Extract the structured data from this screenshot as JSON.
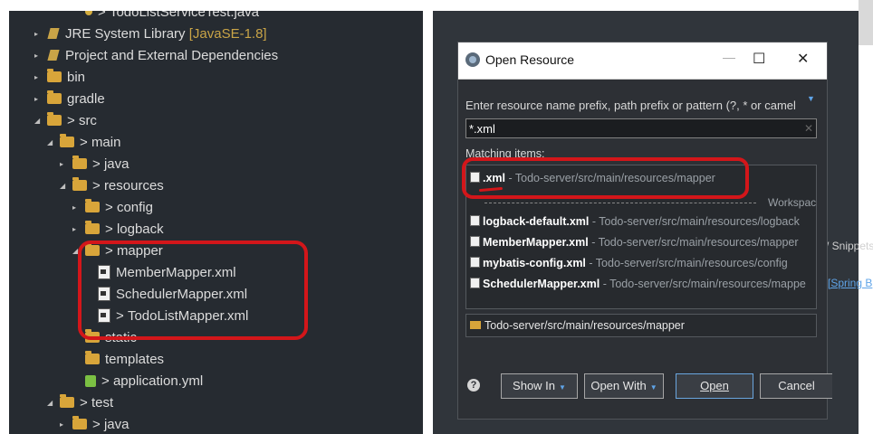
{
  "project_explorer": {
    "rows": [
      {
        "label": "TodoListServiceTest.java",
        "prefix": "> ",
        "indent": 4,
        "icon": "java-file-icon",
        "expand": ""
      },
      {
        "label": "JRE System Library",
        "suffix": " [JavaSE-1.8]",
        "prefix": "",
        "indent": 1,
        "icon": "library-icon",
        "expand": "▸"
      },
      {
        "label": "Project and External Dependencies",
        "prefix": "",
        "indent": 1,
        "icon": "library-icon",
        "expand": "▸"
      },
      {
        "label": "bin",
        "prefix": "",
        "indent": 1,
        "icon": "folder-icon",
        "expand": "▸"
      },
      {
        "label": "gradle",
        "prefix": "",
        "indent": 1,
        "icon": "folder-icon",
        "expand": "▸"
      },
      {
        "label": "src",
        "prefix": "> ",
        "indent": 1,
        "icon": "folder-icon",
        "expand": "◢"
      },
      {
        "label": "main",
        "prefix": "> ",
        "indent": 2,
        "icon": "folder-icon",
        "expand": "◢"
      },
      {
        "label": "java",
        "prefix": "> ",
        "indent": 3,
        "icon": "folder-icon",
        "expand": "▸"
      },
      {
        "label": "resources",
        "prefix": "> ",
        "indent": 3,
        "icon": "folder-icon",
        "expand": "◢"
      },
      {
        "label": "config",
        "prefix": "> ",
        "indent": 4,
        "icon": "folder-icon",
        "expand": "▸"
      },
      {
        "label": "logback",
        "prefix": "> ",
        "indent": 4,
        "icon": "folder-icon",
        "expand": "▸"
      },
      {
        "label": "mapper",
        "prefix": "> ",
        "indent": 4,
        "icon": "folder-icon",
        "expand": "◢"
      },
      {
        "label": "MemberMapper.xml",
        "prefix": "",
        "indent": 5,
        "icon": "xml-file-icon",
        "expand": ""
      },
      {
        "label": "SchedulerMapper.xml",
        "prefix": "",
        "indent": 5,
        "icon": "xml-file-icon",
        "expand": ""
      },
      {
        "label": "TodoListMapper.xml",
        "prefix": "> ",
        "indent": 5,
        "icon": "xml-file-icon",
        "expand": ""
      },
      {
        "label": "static",
        "prefix": "",
        "indent": 4,
        "icon": "folder-icon",
        "expand": ""
      },
      {
        "label": "templates",
        "prefix": "",
        "indent": 4,
        "icon": "folder-icon",
        "expand": ""
      },
      {
        "label": "application.yml",
        "prefix": "> ",
        "indent": 4,
        "icon": "yml-file-icon",
        "expand": ""
      },
      {
        "label": "test",
        "prefix": "> ",
        "indent": 2,
        "icon": "folder-icon",
        "expand": "◢"
      },
      {
        "label": "java",
        "prefix": "> ",
        "indent": 3,
        "icon": "folder-icon",
        "expand": "▸"
      }
    ]
  },
  "dialog": {
    "title": "Open Resource",
    "minimize": "—",
    "maximize": "☐",
    "close": "✕",
    "prompt": "Enter resource name prefix, path prefix or pattern (?, * or camel",
    "filter_value": "*.xml",
    "matching_label": "Matching items:",
    "workspace_separator": "Workspac",
    "items": [
      {
        "name": ".xml",
        "path": " - Todo-server/src/main/resources/mapper"
      },
      {
        "name": "logback-default.xml",
        "path": " - Todo-server/src/main/resources/logback"
      },
      {
        "name": "MemberMapper.xml",
        "path": " - Todo-server/src/main/resources/mapper"
      },
      {
        "name": "mybatis-config.xml",
        "path": " - Todo-server/src/main/resources/config"
      },
      {
        "name": "SchedulerMapper.xml",
        "path": " - Todo-server/src/main/resources/mappe"
      }
    ],
    "selected_path": "Todo-server/src/main/resources/mapper",
    "buttons": {
      "show_in": "Show In",
      "open_with": "Open With",
      "open": "Open",
      "cancel": "Cancel"
    }
  },
  "background": {
    "snippets": "/ Snippets",
    "spring": "[Spring B"
  },
  "colors": {
    "highlight": "#d3161a",
    "folder": "#d8a53a",
    "panel_bg": "#262b31"
  }
}
